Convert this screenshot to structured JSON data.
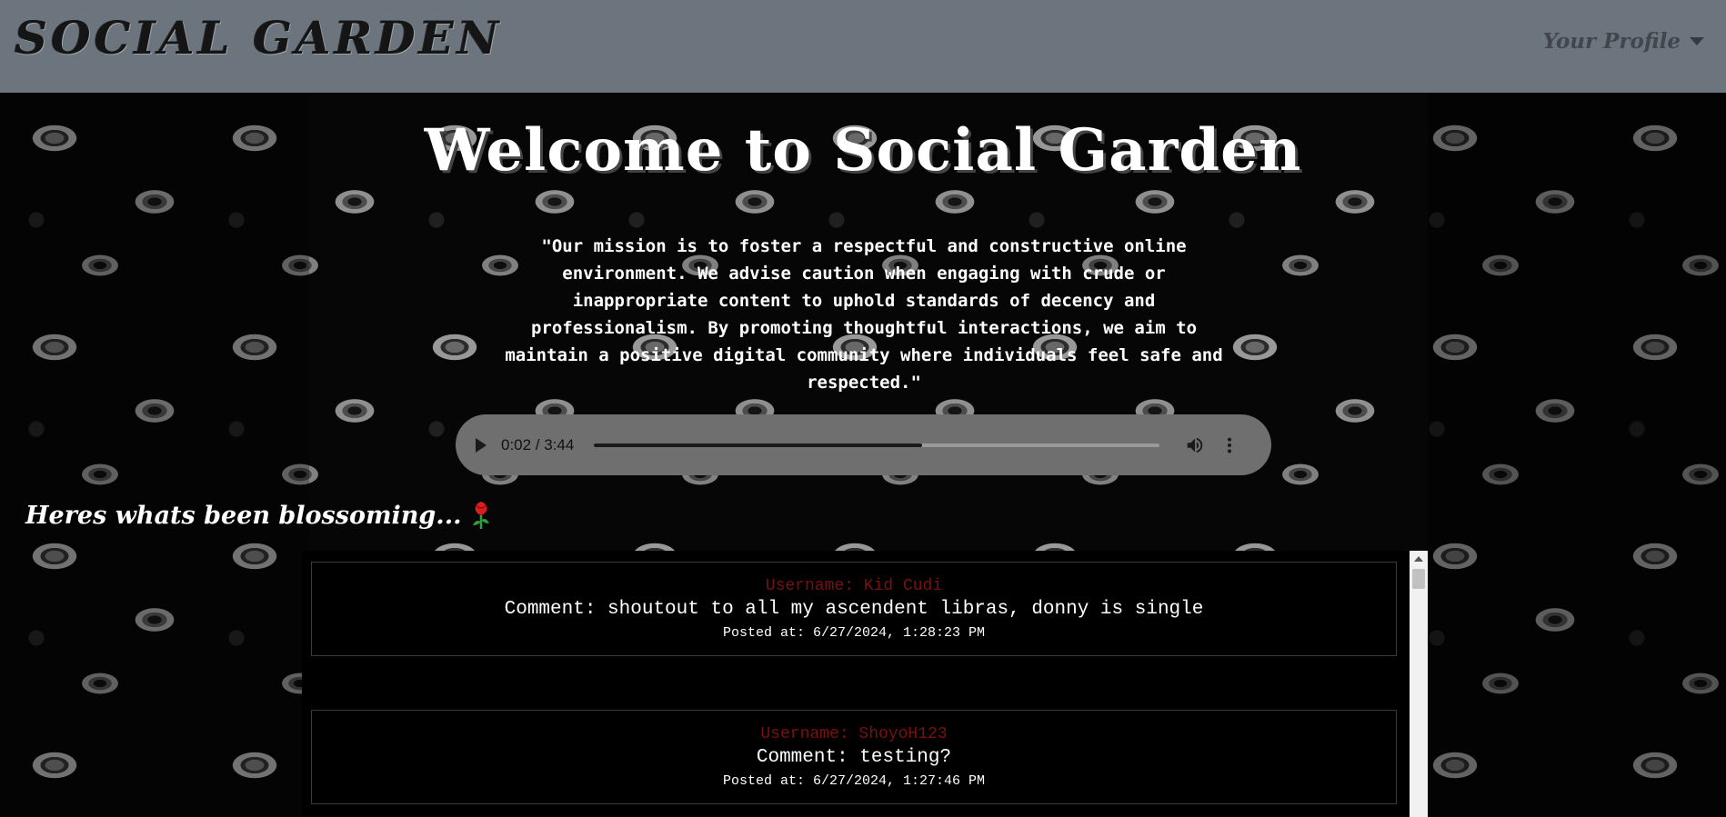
{
  "navbar": {
    "logo": "SOCIAL GARDEN",
    "profile_label": "Your Profile",
    "profile_caret_icon": "caret-down-icon"
  },
  "hero": {
    "title": "Welcome to Social Garden",
    "mission": "\"Our mission is to foster a respectful and constructive online environment. We advise caution when engaging with crude or inappropriate content to uphold standards of decency and professionalism. By promoting thoughtful interactions, we aim to maintain a positive digital community where individuals feel safe and respected.\""
  },
  "audio": {
    "time": "0:02 / 3:44",
    "progress": 0.58,
    "play_icon": "play-icon",
    "volume_icon": "volume-icon",
    "more_icon": "more-vertical-icon"
  },
  "feed": {
    "heading": "Heres whats been blossoming...",
    "heading_icon": "rose-icon",
    "posts": [
      {
        "username": "Username: Kid Cudi",
        "comment": "Comment: shoutout to all my ascendent libras, donny is single",
        "posted": "Posted at: 6/27/2024, 1:28:23 PM"
      },
      {
        "username": "Username: ShoyoH123",
        "comment": "Comment: testing?",
        "posted": "Posted at: 6/27/2024, 1:27:46 PM"
      }
    ]
  },
  "colors": {
    "navbar": "#6c757d",
    "username": "#7a1010",
    "audio_bg": "#6f6f6f"
  }
}
